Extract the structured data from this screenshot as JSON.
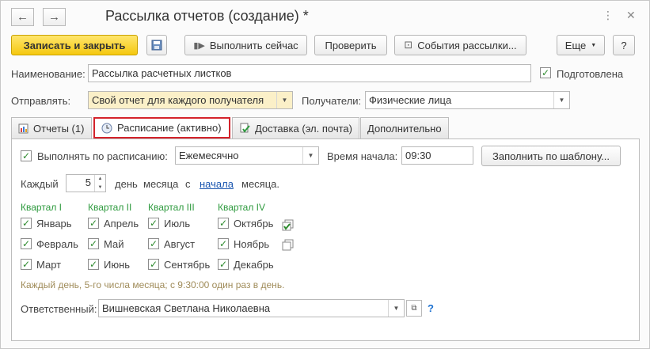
{
  "window": {
    "title": "Рассылка отчетов (создание) *",
    "back": "←",
    "forward": "→",
    "menu_dots": "⋮",
    "close": "✕"
  },
  "toolbar": {
    "save_close": "Записать и закрыть",
    "run_now": "Выполнить сейчас",
    "check": "Проверить",
    "events": "События рассылки...",
    "more": "Еще",
    "help": "?"
  },
  "form": {
    "name_label": "Наименование:",
    "name_value": "Рассылка расчетных листков",
    "prepared_label": "Подготовлена",
    "prepared_checked": true,
    "send_label": "Отправлять:",
    "send_value": "Свой отчет для каждого получателя",
    "recipients_label": "Получатели:",
    "recipients_value": "Физические лица"
  },
  "tabs": [
    {
      "label": "Отчеты (1)"
    },
    {
      "label": "Расписание (активно)"
    },
    {
      "label": "Доставка (эл. почта)"
    },
    {
      "label": "Дополнительно"
    }
  ],
  "schedule": {
    "run_label": "Выполнять по расписанию:",
    "run_checked": true,
    "period_value": "Ежемесячно",
    "start_label": "Время начала:",
    "start_value": "09:30",
    "template_button": "Заполнить по шаблону...",
    "every_label": "Каждый",
    "day_value": "5",
    "day_word": "день",
    "month_word": "месяца",
    "c_word": "с",
    "from_link": "начала",
    "month_word2": "месяца.",
    "quarters": [
      {
        "title": "Квартал I",
        "months": [
          "Январь",
          "Февраль",
          "Март"
        ]
      },
      {
        "title": "Квартал II",
        "months": [
          "Апрель",
          "Май",
          "Июнь"
        ]
      },
      {
        "title": "Квартал III",
        "months": [
          "Июль",
          "Август",
          "Сентябрь"
        ]
      },
      {
        "title": "Квартал IV",
        "months": [
          "Октябрь",
          "Ноябрь",
          "Декабрь"
        ]
      }
    ],
    "summary": "Каждый день, 5-го числа месяца; с 9:30:00 один раз в день.",
    "responsible_label": "Ответственный:",
    "responsible_value": "Вишневская Светлана Николаевна",
    "help": "?"
  },
  "icons": {
    "check": "✓",
    "dropdown": "▼",
    "open": "⧉",
    "spin_up": "▲",
    "spin_down": "▼"
  }
}
